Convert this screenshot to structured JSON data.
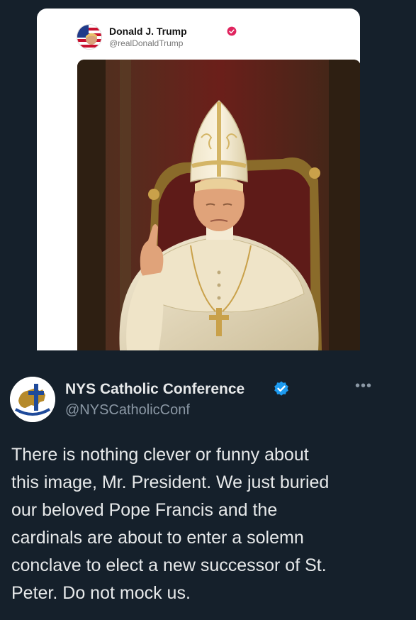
{
  "embedded_post": {
    "display_name": "Donald J. Trump",
    "handle": "@realDonaldTrump",
    "verified_icon": "verified-badge-icon",
    "image": "ai-generated-pope-image"
  },
  "tweet": {
    "display_name": "NYS Catholic Conference",
    "handle": "@NYSCatholicConf",
    "more_label": "•••",
    "verified_color": "#1d9bf0",
    "text": "There is nothing clever or funny about\nthis image, Mr. President. We just buried\nour beloved Pope Francis and the\ncardinals are about to enter a solemn\nconclave to elect a new successor of St.\nPeter. Do not mock us."
  },
  "colors": {
    "background": "#15202b",
    "text_primary": "#e7e9ea",
    "text_secondary": "#8b98a5",
    "accent": "#1d9bf0"
  }
}
